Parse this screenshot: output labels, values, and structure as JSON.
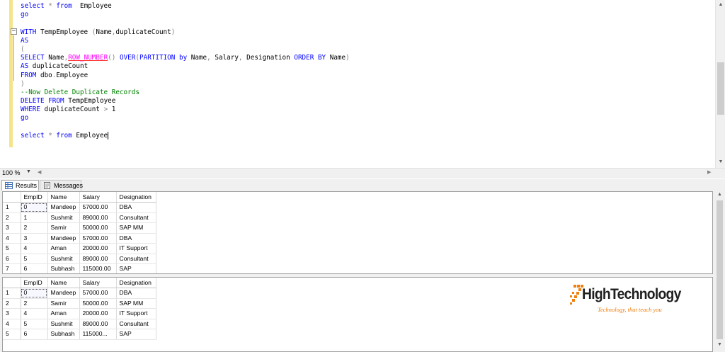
{
  "editor": {
    "lines": [
      [
        [
          "kw",
          "select"
        ],
        [
          "gr",
          " * "
        ],
        [
          "kw",
          "from"
        ],
        [
          "",
          "  Employee"
        ]
      ],
      [
        [
          "kw",
          "go"
        ]
      ],
      [],
      [
        [
          "kw",
          "WITH"
        ],
        [
          "",
          " TempEmployee "
        ],
        [
          "gr",
          "("
        ],
        [
          "",
          "Name"
        ],
        [
          "gr",
          ","
        ],
        [
          "",
          "duplicateCount"
        ],
        [
          "gr",
          ")"
        ]
      ],
      [
        [
          "kw",
          "AS"
        ]
      ],
      [
        [
          "gr",
          "("
        ]
      ],
      [
        [
          "kw",
          "SELECT"
        ],
        [
          "",
          " Name"
        ],
        [
          "gr",
          ","
        ],
        [
          "fnu",
          "ROW_NUMBER"
        ],
        [
          "gr",
          "()"
        ],
        [
          "kw",
          " OVER"
        ],
        [
          "gr",
          "("
        ],
        [
          "kw",
          "PARTITION"
        ],
        [
          "kw",
          " by"
        ],
        [
          "",
          " Name"
        ],
        [
          "gr",
          ","
        ],
        [
          "",
          " Salary"
        ],
        [
          "gr",
          ","
        ],
        [
          "",
          " Designation "
        ],
        [
          "kw",
          "ORDER"
        ],
        [
          "kw",
          " BY"
        ],
        [
          "",
          " Name"
        ],
        [
          "gr",
          ")"
        ]
      ],
      [
        [
          "kw",
          "AS"
        ],
        [
          "",
          " duplicateCount"
        ]
      ],
      [
        [
          "kw",
          "FROM"
        ],
        [
          "",
          " dbo"
        ],
        [
          "gr",
          "."
        ],
        [
          "",
          "Employee"
        ]
      ],
      [
        [
          "gr",
          ")"
        ]
      ],
      [
        [
          "cm",
          "--Now Delete Duplicate Records"
        ]
      ],
      [
        [
          "kw",
          "DELETE"
        ],
        [
          "kw",
          " FROM"
        ],
        [
          "",
          " TempEmployee"
        ]
      ],
      [
        [
          "kw",
          "WHERE"
        ],
        [
          "",
          " duplicateCount "
        ],
        [
          "gr",
          ">"
        ],
        [
          "",
          " 1"
        ]
      ],
      [
        [
          "kw",
          "go"
        ]
      ],
      [],
      [
        [
          "kw",
          "select"
        ],
        [
          "gr",
          " * "
        ],
        [
          "kw",
          "from"
        ],
        [
          "",
          " Employee"
        ],
        [
          "cursor",
          ""
        ]
      ]
    ]
  },
  "zoom": {
    "label": "100 %"
  },
  "tabs": {
    "results": "Results",
    "messages": "Messages"
  },
  "grid1": {
    "columns": [
      "EmpID",
      "Name",
      "Salary",
      "Designation"
    ],
    "rows": [
      [
        "1",
        "0",
        "Mandeep",
        "57000.00",
        "DBA"
      ],
      [
        "2",
        "1",
        "Sushmit",
        "89000.00",
        "Consultant"
      ],
      [
        "3",
        "2",
        "Samir",
        "50000.00",
        "SAP MM"
      ],
      [
        "4",
        "3",
        "Mandeep",
        "57000.00",
        "DBA"
      ],
      [
        "5",
        "4",
        "Aman",
        "20000.00",
        "IT Support"
      ],
      [
        "6",
        "5",
        "Sushmit",
        "89000.00",
        "Consultant"
      ],
      [
        "7",
        "6",
        "Subhash",
        "115000.00",
        "SAP"
      ]
    ]
  },
  "grid2": {
    "columns": [
      "EmpID",
      "Name",
      "Salary",
      "Designation"
    ],
    "rows": [
      [
        "1",
        "0",
        "Mandeep",
        "57000.00",
        "DBA"
      ],
      [
        "2",
        "2",
        "Samir",
        "50000.00",
        "SAP MM"
      ],
      [
        "3",
        "4",
        "Aman",
        "20000.00",
        "IT Support"
      ],
      [
        "4",
        "5",
        "Sushmit",
        "89000.00",
        "Consultant"
      ],
      [
        "5",
        "6",
        "Subhash",
        "115000...",
        "SAP"
      ]
    ]
  },
  "logo": {
    "title": "HighTechnology",
    "tagline": "Technology, that teach you",
    "accent": "#f07f0e"
  }
}
